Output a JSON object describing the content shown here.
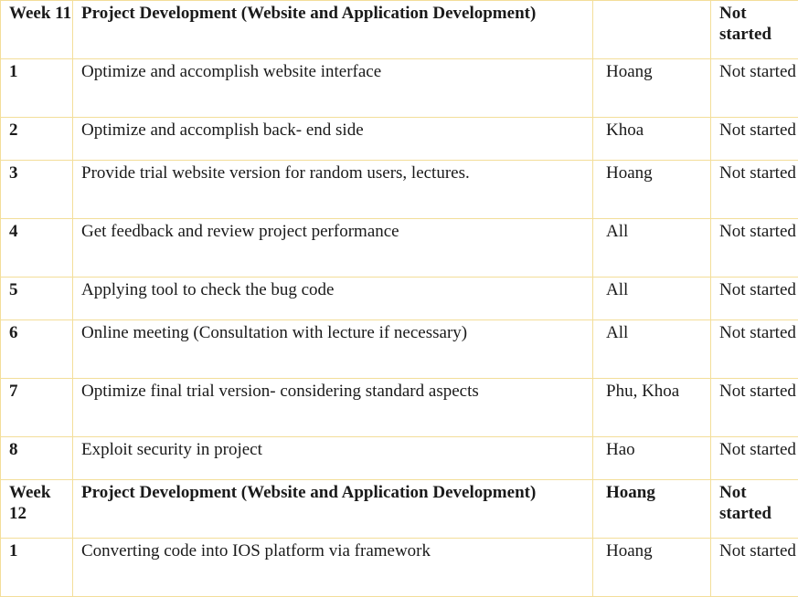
{
  "rows": [
    {
      "num": "Week 11",
      "task": "Project Development (Website and Application Development)",
      "owner": "",
      "status": "Not started",
      "header": true
    },
    {
      "num": "1",
      "task": "Optimize and accomplish website interface",
      "owner": "Hoang",
      "status": "Not started"
    },
    {
      "num": "2",
      "task": "Optimize and accomplish back- end side",
      "owner": "Khoa",
      "status": "Not started"
    },
    {
      "num": "3",
      "task": "Provide trial website version for random users, lectures.",
      "owner": "Hoang",
      "status": "Not started"
    },
    {
      "num": "4",
      "task": "Get feedback and review project performance",
      "owner": "All",
      "status": "Not started"
    },
    {
      "num": "5",
      "task": "Applying tool to check the bug code",
      "owner": "All",
      "status": "Not started"
    },
    {
      "num": "6",
      "task": "Online meeting (Consultation with lecture if necessary)",
      "owner": "All",
      "status": "Not started"
    },
    {
      "num": "7",
      "task": "Optimize final trial version- considering standard aspects",
      "owner": "Phu, Khoa",
      "status": "Not started"
    },
    {
      "num": "8",
      "task": "Exploit security in project",
      "owner": "Hao",
      "status": "Not started"
    },
    {
      "num": "Week 12",
      "task": "Project Development (Website and Application Development)",
      "owner": "Hoang",
      "status": "Not started",
      "header": true
    },
    {
      "num": "1",
      "task": "Converting code into IOS platform via framework",
      "owner": "Hoang",
      "status": "Not started"
    }
  ]
}
